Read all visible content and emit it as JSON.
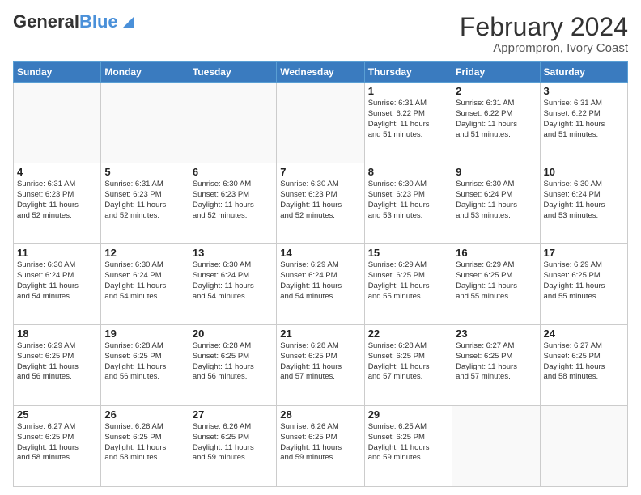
{
  "header": {
    "logo_general": "General",
    "logo_blue": "Blue",
    "month_title": "February 2024",
    "location": "Apprompron, Ivory Coast"
  },
  "weekdays": [
    "Sunday",
    "Monday",
    "Tuesday",
    "Wednesday",
    "Thursday",
    "Friday",
    "Saturday"
  ],
  "weeks": [
    [
      {
        "day": "",
        "info": ""
      },
      {
        "day": "",
        "info": ""
      },
      {
        "day": "",
        "info": ""
      },
      {
        "day": "",
        "info": ""
      },
      {
        "day": "1",
        "info": "Sunrise: 6:31 AM\nSunset: 6:22 PM\nDaylight: 11 hours\nand 51 minutes."
      },
      {
        "day": "2",
        "info": "Sunrise: 6:31 AM\nSunset: 6:22 PM\nDaylight: 11 hours\nand 51 minutes."
      },
      {
        "day": "3",
        "info": "Sunrise: 6:31 AM\nSunset: 6:22 PM\nDaylight: 11 hours\nand 51 minutes."
      }
    ],
    [
      {
        "day": "4",
        "info": "Sunrise: 6:31 AM\nSunset: 6:23 PM\nDaylight: 11 hours\nand 52 minutes."
      },
      {
        "day": "5",
        "info": "Sunrise: 6:31 AM\nSunset: 6:23 PM\nDaylight: 11 hours\nand 52 minutes."
      },
      {
        "day": "6",
        "info": "Sunrise: 6:30 AM\nSunset: 6:23 PM\nDaylight: 11 hours\nand 52 minutes."
      },
      {
        "day": "7",
        "info": "Sunrise: 6:30 AM\nSunset: 6:23 PM\nDaylight: 11 hours\nand 52 minutes."
      },
      {
        "day": "8",
        "info": "Sunrise: 6:30 AM\nSunset: 6:23 PM\nDaylight: 11 hours\nand 53 minutes."
      },
      {
        "day": "9",
        "info": "Sunrise: 6:30 AM\nSunset: 6:24 PM\nDaylight: 11 hours\nand 53 minutes."
      },
      {
        "day": "10",
        "info": "Sunrise: 6:30 AM\nSunset: 6:24 PM\nDaylight: 11 hours\nand 53 minutes."
      }
    ],
    [
      {
        "day": "11",
        "info": "Sunrise: 6:30 AM\nSunset: 6:24 PM\nDaylight: 11 hours\nand 54 minutes."
      },
      {
        "day": "12",
        "info": "Sunrise: 6:30 AM\nSunset: 6:24 PM\nDaylight: 11 hours\nand 54 minutes."
      },
      {
        "day": "13",
        "info": "Sunrise: 6:30 AM\nSunset: 6:24 PM\nDaylight: 11 hours\nand 54 minutes."
      },
      {
        "day": "14",
        "info": "Sunrise: 6:29 AM\nSunset: 6:24 PM\nDaylight: 11 hours\nand 54 minutes."
      },
      {
        "day": "15",
        "info": "Sunrise: 6:29 AM\nSunset: 6:25 PM\nDaylight: 11 hours\nand 55 minutes."
      },
      {
        "day": "16",
        "info": "Sunrise: 6:29 AM\nSunset: 6:25 PM\nDaylight: 11 hours\nand 55 minutes."
      },
      {
        "day": "17",
        "info": "Sunrise: 6:29 AM\nSunset: 6:25 PM\nDaylight: 11 hours\nand 55 minutes."
      }
    ],
    [
      {
        "day": "18",
        "info": "Sunrise: 6:29 AM\nSunset: 6:25 PM\nDaylight: 11 hours\nand 56 minutes."
      },
      {
        "day": "19",
        "info": "Sunrise: 6:28 AM\nSunset: 6:25 PM\nDaylight: 11 hours\nand 56 minutes."
      },
      {
        "day": "20",
        "info": "Sunrise: 6:28 AM\nSunset: 6:25 PM\nDaylight: 11 hours\nand 56 minutes."
      },
      {
        "day": "21",
        "info": "Sunrise: 6:28 AM\nSunset: 6:25 PM\nDaylight: 11 hours\nand 57 minutes."
      },
      {
        "day": "22",
        "info": "Sunrise: 6:28 AM\nSunset: 6:25 PM\nDaylight: 11 hours\nand 57 minutes."
      },
      {
        "day": "23",
        "info": "Sunrise: 6:27 AM\nSunset: 6:25 PM\nDaylight: 11 hours\nand 57 minutes."
      },
      {
        "day": "24",
        "info": "Sunrise: 6:27 AM\nSunset: 6:25 PM\nDaylight: 11 hours\nand 58 minutes."
      }
    ],
    [
      {
        "day": "25",
        "info": "Sunrise: 6:27 AM\nSunset: 6:25 PM\nDaylight: 11 hours\nand 58 minutes."
      },
      {
        "day": "26",
        "info": "Sunrise: 6:26 AM\nSunset: 6:25 PM\nDaylight: 11 hours\nand 58 minutes."
      },
      {
        "day": "27",
        "info": "Sunrise: 6:26 AM\nSunset: 6:25 PM\nDaylight: 11 hours\nand 59 minutes."
      },
      {
        "day": "28",
        "info": "Sunrise: 6:26 AM\nSunset: 6:25 PM\nDaylight: 11 hours\nand 59 minutes."
      },
      {
        "day": "29",
        "info": "Sunrise: 6:25 AM\nSunset: 6:25 PM\nDaylight: 11 hours\nand 59 minutes."
      },
      {
        "day": "",
        "info": ""
      },
      {
        "day": "",
        "info": ""
      }
    ]
  ]
}
